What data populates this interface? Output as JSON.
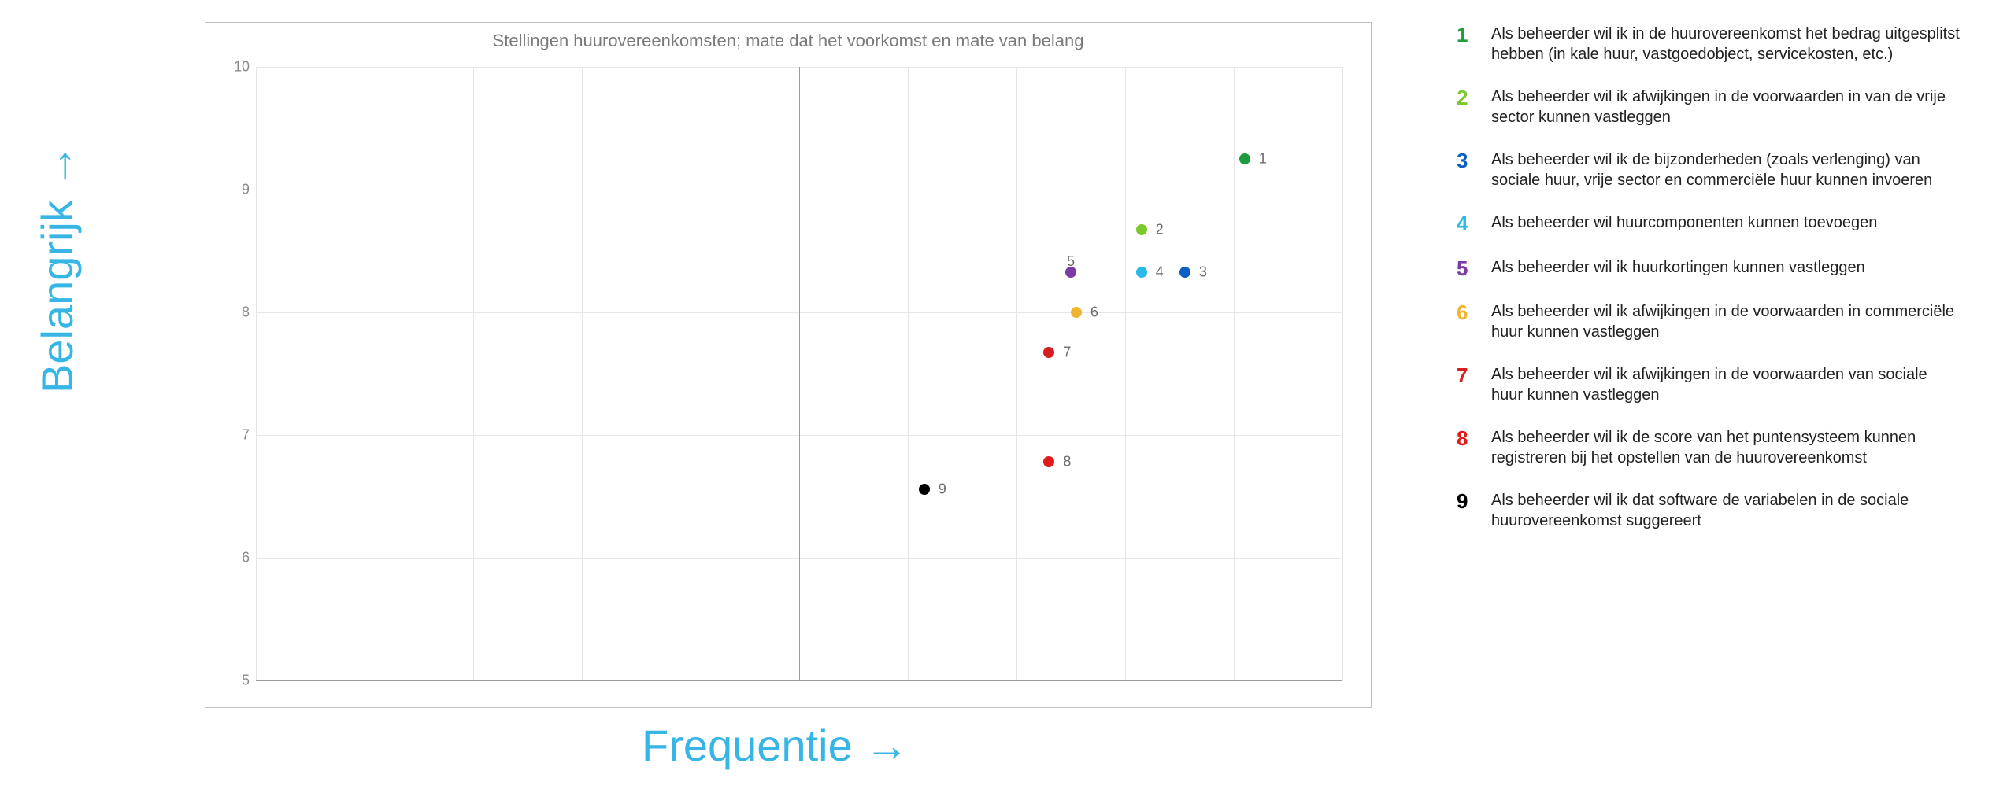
{
  "axis_labels": {
    "y": "Belangrijk →",
    "x": "Frequentie →"
  },
  "chart_data": {
    "type": "scatter",
    "title": "Stellingen huurovereenkomsten; mate dat het voorkomst en mate van belang",
    "xlabel": "Frequentie",
    "ylabel": "Belangrijk",
    "xlim": [
      0,
      10
    ],
    "ylim": [
      5,
      10
    ],
    "yticks": [
      5,
      6,
      7,
      8,
      9,
      10
    ],
    "x_gridlines": [
      0,
      1,
      2,
      3,
      4,
      5,
      6,
      7,
      8,
      9,
      10
    ],
    "x_center_line": 5,
    "points": [
      {
        "id": 1,
        "x": 9.1,
        "y": 9.25,
        "color": "#1e9b3a",
        "label_pos": "right"
      },
      {
        "id": 2,
        "x": 8.15,
        "y": 8.67,
        "color": "#7cc92e",
        "label_pos": "right"
      },
      {
        "id": 3,
        "x": 8.55,
        "y": 8.33,
        "color": "#0b5fc2",
        "label_pos": "right"
      },
      {
        "id": 4,
        "x": 8.15,
        "y": 8.33,
        "color": "#29b8e8",
        "label_pos": "right"
      },
      {
        "id": 5,
        "x": 7.5,
        "y": 8.33,
        "color": "#7c3aa8",
        "label_pos": "above"
      },
      {
        "id": 6,
        "x": 7.55,
        "y": 8.0,
        "color": "#f2b430",
        "label_pos": "right"
      },
      {
        "id": 7,
        "x": 7.3,
        "y": 7.67,
        "color": "#d31f1f",
        "label_pos": "right"
      },
      {
        "id": 8,
        "x": 7.3,
        "y": 6.78,
        "color": "#e01919",
        "label_pos": "right"
      },
      {
        "id": 9,
        "x": 6.15,
        "y": 6.56,
        "color": "#000000",
        "label_pos": "right"
      }
    ]
  },
  "legend": [
    {
      "num": "1",
      "color": "#1e9b3a",
      "text": "Als beheerder wil ik in de huurovereenkomst het bedrag uitgesplitst hebben (in kale huur, vastgoedobject, servicekosten, etc.)"
    },
    {
      "num": "2",
      "color": "#7cc92e",
      "text": "Als beheerder wil ik afwijkingen in de voorwaarden in van de vrije sector kunnen vastleggen"
    },
    {
      "num": "3",
      "color": "#0b5fc2",
      "text": "Als beheerder wil ik de bijzonderheden (zoals verlenging) van sociale huur, vrije sector en commerciële huur kunnen invoeren"
    },
    {
      "num": "4",
      "color": "#29b8e8",
      "text": "Als beheerder wil huurcomponenten kunnen toevoegen"
    },
    {
      "num": "5",
      "color": "#7c3aa8",
      "text": "Als beheerder wil ik huurkortingen kunnen vastleggen"
    },
    {
      "num": "6",
      "color": "#f2b430",
      "text": "Als beheerder wil ik afwijkingen in de voorwaarden in commerciële huur kunnen vastleggen"
    },
    {
      "num": "7",
      "color": "#d31f1f",
      "text": "Als beheerder wil ik afwijkingen in de voorwaarden van sociale huur kunnen vastleggen"
    },
    {
      "num": "8",
      "color": "#e01919",
      "text": "Als beheerder wil ik de score van het puntensysteem kunnen registreren bij het opstellen van de huurovereenkomst"
    },
    {
      "num": "9",
      "color": "#000000",
      "text": "Als beheerder wil ik dat software de variabelen in de sociale huurovereenkomst suggereert"
    }
  ]
}
